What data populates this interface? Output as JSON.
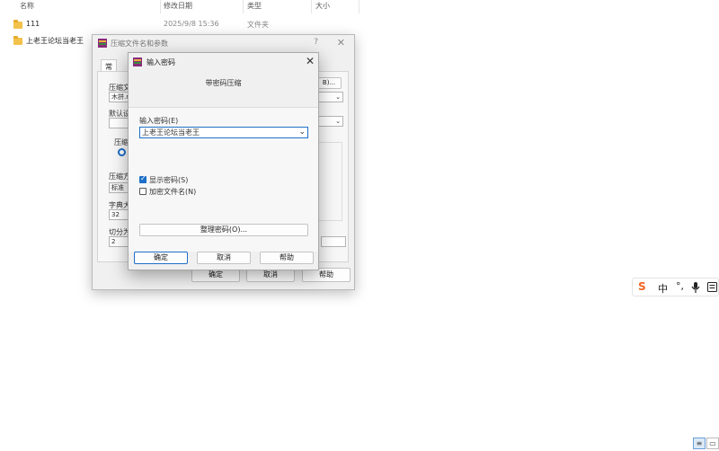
{
  "explorer": {
    "columns": {
      "name": "名称",
      "modified": "修改日期",
      "type": "类型",
      "size": "大小"
    },
    "rows": [
      {
        "name": "111",
        "modified": "2025/9/8 15:36",
        "type": "文件夹"
      },
      {
        "name": "上老王论坛当老王",
        "modified": "",
        "type": ""
      }
    ]
  },
  "parent_dialog": {
    "title": "压缩文件名和参数",
    "help_glyph": "?",
    "close_glyph": "✕",
    "tab": "常规",
    "label_archive_name": "压缩文",
    "archive_name_value": "木拼.r",
    "browse_button": "B)...",
    "label_default": "默认设",
    "label_format": "压缩",
    "radio_label": "r",
    "label_method": "压缩方",
    "method_value": "标准",
    "label_dict": "字典大",
    "dict_value": "32",
    "label_split": "切分为",
    "split_value": "2",
    "ok": "确定",
    "cancel": "取消",
    "help": "帮助"
  },
  "password_dialog": {
    "title": "输入密码",
    "close_glyph": "✕",
    "subtitle": "带密码压缩",
    "input_label": "输入密码(E)",
    "input_value": "上老王论坛当老王",
    "show_password": "显示密码(S)",
    "show_password_checked": true,
    "encrypt_names": "加密文件名(N)",
    "encrypt_names_checked": false,
    "organize_button": "整理密码(O)...",
    "ok": "确定",
    "cancel": "取消",
    "help": "帮助"
  },
  "ime": {
    "logo": "S",
    "lang": "中",
    "punct": "°,"
  },
  "colors": {
    "accent": "#1e6fc9",
    "folder": "#f2c24a",
    "ime_logo": "#f26522"
  }
}
